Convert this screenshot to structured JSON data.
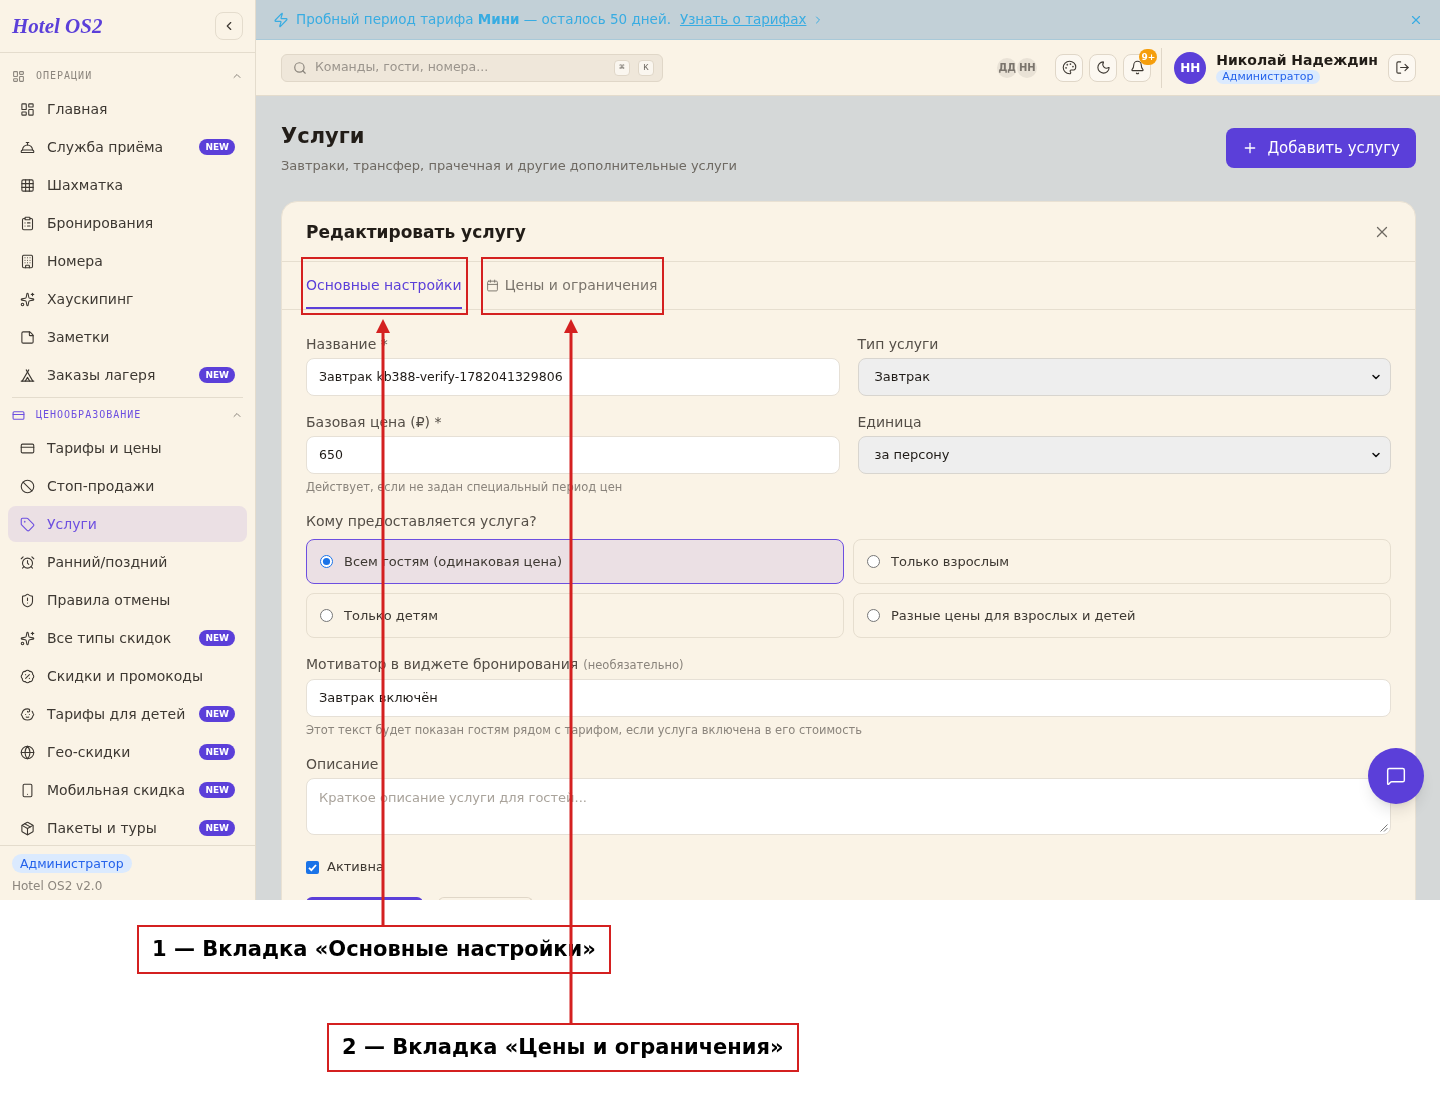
{
  "sidebar": {
    "logo": "Hotel OS2",
    "sections": [
      {
        "title": "ОПЕРАЦИИ",
        "expanded": true,
        "items": [
          {
            "label": "Главная",
            "selected": false
          },
          {
            "label": "Служба приёма",
            "badge": "NEW",
            "selected": false
          },
          {
            "label": "Шахматка",
            "selected": false
          },
          {
            "label": "Бронирования",
            "selected": false
          },
          {
            "label": "Номера",
            "selected": false
          },
          {
            "label": "Хаускипинг",
            "selected": false
          },
          {
            "label": "Заметки",
            "selected": false
          },
          {
            "label": "Заказы лагеря",
            "badge": "NEW",
            "selected": false
          }
        ]
      },
      {
        "title": "ЦЕНООБРАЗОВАНИЕ",
        "expanded": true,
        "items": [
          {
            "label": "Тарифы и цены",
            "selected": false
          },
          {
            "label": "Стоп-продажи",
            "selected": false
          },
          {
            "label": "Услуги",
            "selected": true
          },
          {
            "label": "Ранний/поздний",
            "selected": false
          },
          {
            "label": "Правила отмены",
            "selected": false
          },
          {
            "label": "Все типы скидок",
            "badge": "NEW",
            "selected": false
          },
          {
            "label": "Скидки и промокоды",
            "selected": false
          },
          {
            "label": "Тарифы для детей",
            "badge": "NEW",
            "selected": false
          },
          {
            "label": "Гео-скидки",
            "badge": "NEW",
            "selected": false
          },
          {
            "label": "Мобильная скидка",
            "badge": "NEW",
            "selected": false
          },
          {
            "label": "Пакеты и туры",
            "badge": "NEW",
            "selected": false
          }
        ]
      }
    ],
    "footer": {
      "role": "Администратор",
      "version": "Hotel OS2 v2.0"
    }
  },
  "banner": {
    "message": "Пробный период тарифа **Мини** — осталось 50 дней.",
    "link": "Узнать о тарифах"
  },
  "header": {
    "search": {
      "placeholder": "Команды, гости, номера...",
      "shortcut": [
        "⌘",
        "K"
      ]
    },
    "presence": [
      "ДД",
      "НН"
    ],
    "notifications_badge": "9+",
    "user": {
      "initials": "НН",
      "name": "Николай Надеждин",
      "role": "Администратор"
    }
  },
  "page": {
    "title": "Услуги",
    "subtitle": "Завтраки, трансфер, прачечная и другие дополнительные услуги",
    "add_button": "Добавить услугу"
  },
  "dialog": {
    "title": "Редактировать услугу",
    "tabs": [
      {
        "label": "Основные настройки",
        "selected": true
      },
      {
        "label": "Цены и ограничения",
        "selected": false
      }
    ],
    "fields": [
      {
        "kind": "input",
        "label": "Название *",
        "value": "Завтрак kb388-verify-1782041329806"
      },
      {
        "kind": "select",
        "label": "Тип услуги",
        "value": "Завтрак"
      },
      {
        "kind": "input",
        "label": "Базовая цена (₽) *",
        "value": "650",
        "hint": "Действует, если не задан специальный период цен"
      },
      {
        "kind": "select",
        "label": "Единица",
        "value": "за персону"
      }
    ],
    "audience": {
      "label": "Кому предоставляется услуга?",
      "options": [
        {
          "label": "Всем гостям (одинаковая цена)",
          "selected": true
        },
        {
          "label": "Только взрослым",
          "selected": false
        },
        {
          "label": "Только детям",
          "selected": false
        },
        {
          "label": "Разные цены для взрослых и детей",
          "selected": false
        }
      ]
    },
    "motivator": {
      "label": "Мотиватор в виджете бронирования",
      "note": "(необязательно)",
      "value": "Завтрак включён",
      "hint": "Этот текст будет показан гостям рядом с тарифом, если услуга включена в его стоимость"
    },
    "description": {
      "label": "Описание",
      "placeholder": "Краткое описание услуги для гостей..."
    },
    "active": {
      "label": "Активна",
      "checked": true
    },
    "actions": [
      {
        "kind": "primary"
      },
      {
        "kind": "secondary"
      }
    ]
  },
  "annotations": [
    {
      "label": "1 — Вкладка «Основные настройки»"
    },
    {
      "label": "2 — Вкладка «Цены и ограничения»"
    }
  ]
}
